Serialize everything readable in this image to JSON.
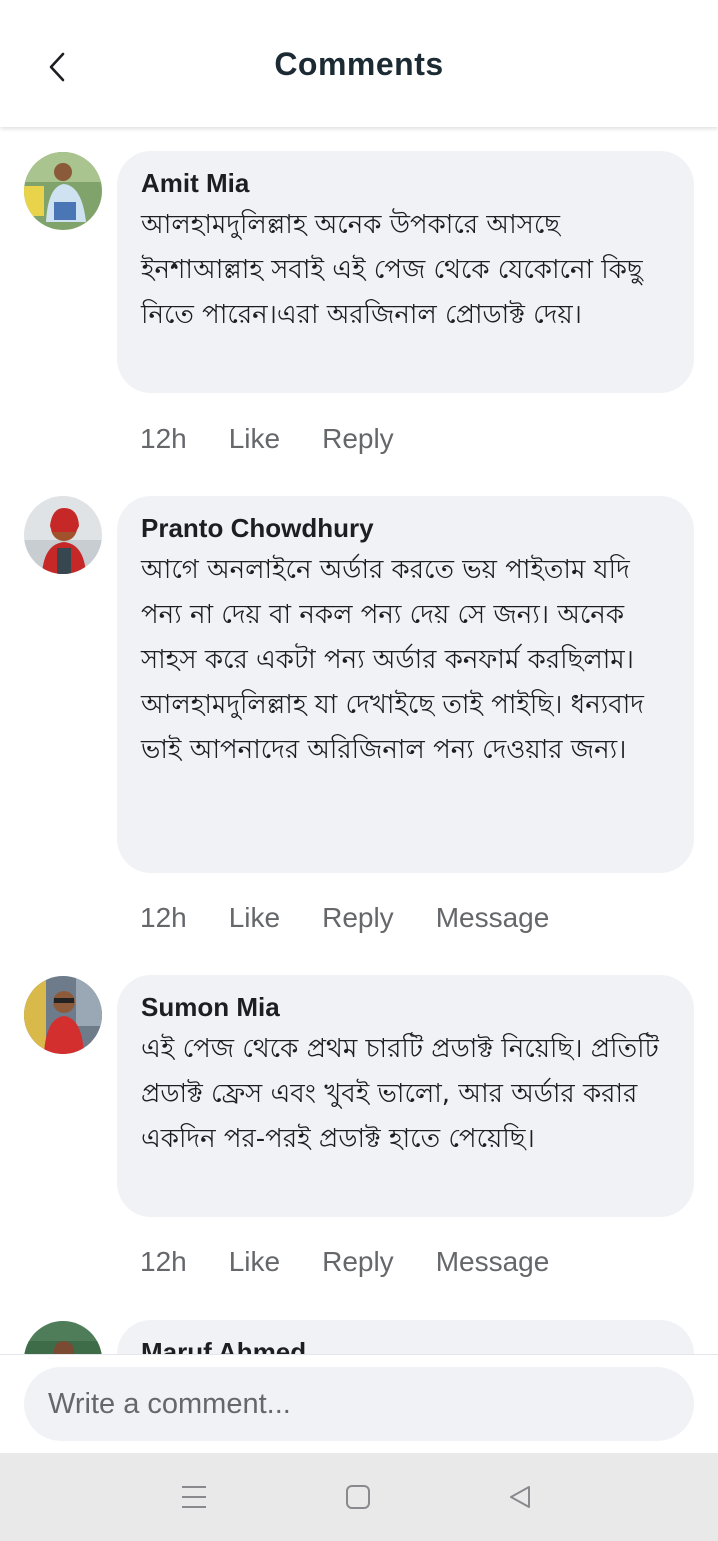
{
  "header": {
    "title": "Comments",
    "back_icon": "chevron-left-icon"
  },
  "comments": [
    {
      "author": "Amit Mia",
      "text": "আলহামদুলিল্লাহ অনেক উপকারে আসছে ইনশাআল্লাহ সবাই এই পেজ থেকে যেকোনো কিছু নিতে পারেন।এরা অরজিনাল প্রোডাক্ট দেয়।",
      "time": "12h",
      "like_label": "Like",
      "reply_label": "Reply"
    },
    {
      "author": "Pranto Chowdhury",
      "text": "আগে অনলাইনে অর্ডার করতে ভয় পাইতাম যদি পন্য না দেয় বা নকল পন্য দেয় সে জন্য। অনেক সাহস করে একটা পন্য অর্ডার কনফার্ম করছিলাম। আলহামদুলিল্লাহ যা দেখাইছে তাই পাইছি। ধন্যবাদ ভাই আপনাদের অরিজিনাল পন্য দেওয়ার জন্য।",
      "time": "12h",
      "like_label": "Like",
      "reply_label": "Reply",
      "message_label": "Message"
    },
    {
      "author": "Sumon Mia",
      "text": "এই পেজ থেকে প্রথম চারটি প্রডাক্ট নিয়েছি। প্রতিটি প্রডাক্ট ফ্রেস এবং খুবই ভালো, আর অর্ডার করার একদিন পর-পরই প্রডাক্ট হাতে পেয়েছি।",
      "time": "12h",
      "like_label": "Like",
      "reply_label": "Reply",
      "message_label": "Message"
    },
    {
      "author": "Maruf Ahmed"
    }
  ],
  "composer": {
    "placeholder": "Write a comment..."
  },
  "navbar": {
    "icons": [
      "menu-icon",
      "home-square-icon",
      "back-triangle-icon"
    ]
  },
  "colors": {
    "bubble": "#f0f2f5",
    "meta_text": "#65676b",
    "title": "#1c2b33"
  }
}
